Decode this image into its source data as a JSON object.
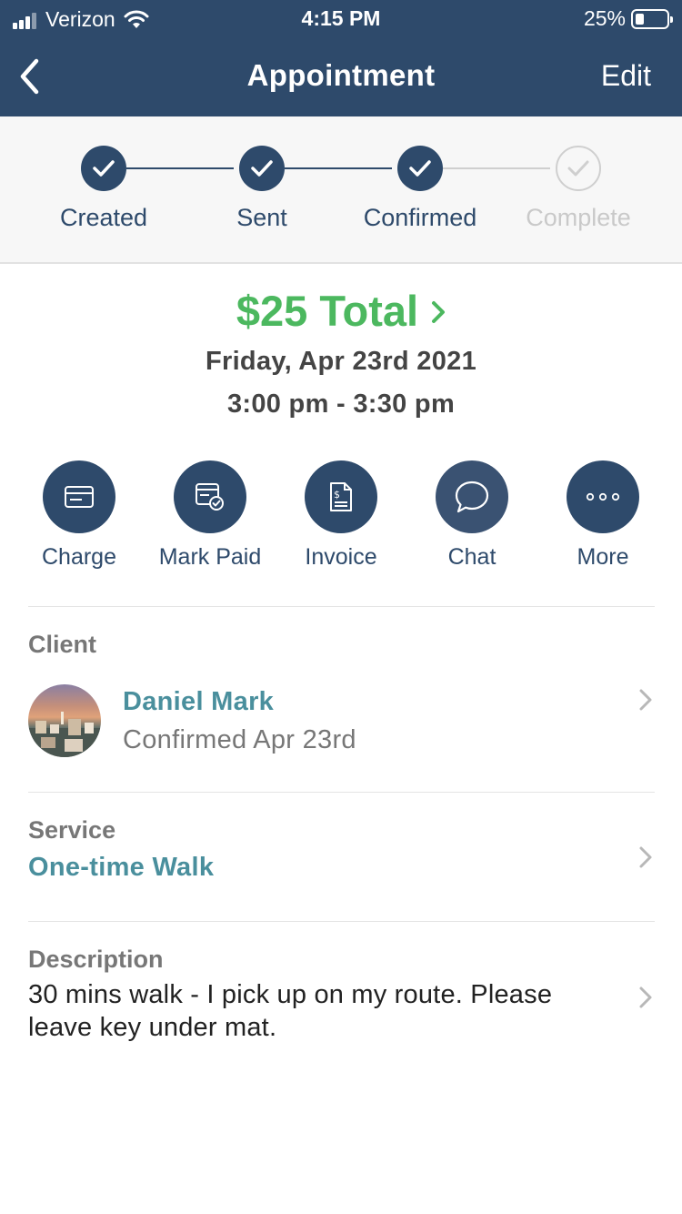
{
  "status_bar": {
    "carrier": "Verizon",
    "time": "4:15 PM",
    "battery": "25%",
    "battery_level": 0.25
  },
  "nav": {
    "title": "Appointment",
    "edit_label": "Edit",
    "back_icon": "chevron-left-icon"
  },
  "steps": [
    {
      "label": "Created",
      "done": true
    },
    {
      "label": "Sent",
      "done": true
    },
    {
      "label": "Confirmed",
      "done": true
    },
    {
      "label": "Complete",
      "done": false
    }
  ],
  "summary": {
    "total": "$25 Total",
    "date": "Friday, Apr 23rd 2021",
    "time_range": "3:00 pm - 3:30 pm"
  },
  "actions": [
    {
      "label": "Charge",
      "icon": "card-icon"
    },
    {
      "label": "Mark Paid",
      "icon": "receipt-check-icon"
    },
    {
      "label": "Invoice",
      "icon": "invoice-icon"
    },
    {
      "label": "Chat",
      "icon": "chat-bubble-icon"
    },
    {
      "label": "More",
      "icon": "ellipsis-icon"
    }
  ],
  "client": {
    "section_label": "Client",
    "name": "Daniel Mark",
    "status": "Confirmed Apr 23rd"
  },
  "service": {
    "section_label": "Service",
    "name": "One-time Walk"
  },
  "description": {
    "section_label": "Description",
    "text": "30 mins walk - I pick up on my route. Please leave key under mat."
  },
  "colors": {
    "header_bg": "#2e4a6b",
    "accent_green": "#4cb85f",
    "link_teal": "#4a8f9d",
    "pending_gray": "#c9c9c9"
  }
}
